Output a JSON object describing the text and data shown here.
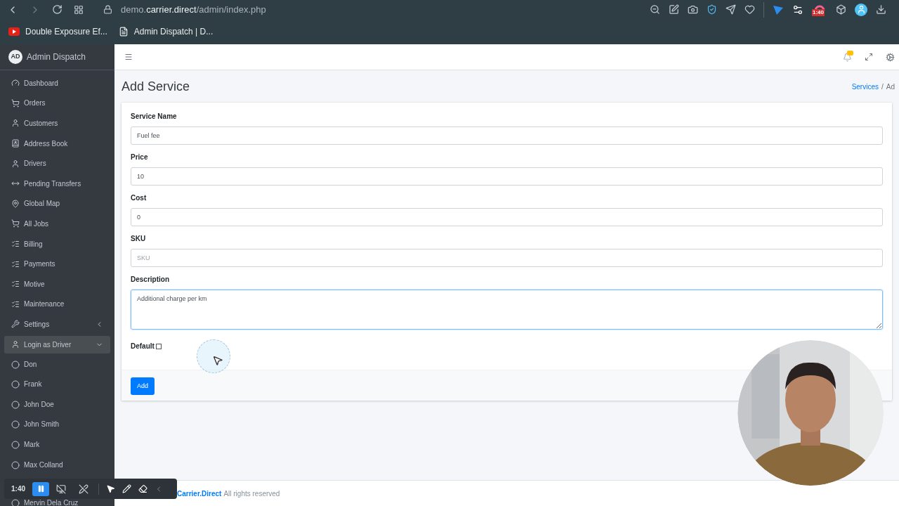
{
  "browser": {
    "url": {
      "scheme_host_prefix": "demo.",
      "host": "carrier.direct",
      "path": "/admin/index.php"
    },
    "extension_badge": "1:40",
    "bookmarks": [
      {
        "label": "Double Exposure Ef...",
        "kind": "video"
      },
      {
        "label": "Admin Dispatch | D...",
        "kind": "page"
      }
    ]
  },
  "sidebar": {
    "avatar": "AD",
    "brand": "Admin Dispatch",
    "items": [
      {
        "label": "Dashboard",
        "kind": "link",
        "selected": false
      },
      {
        "label": "Orders",
        "kind": "link",
        "selected": false
      },
      {
        "label": "Customers",
        "kind": "link",
        "selected": false
      },
      {
        "label": "Address Book",
        "kind": "link",
        "selected": false
      },
      {
        "label": "Drivers",
        "kind": "link",
        "selected": false
      },
      {
        "label": "Pending Transfers",
        "kind": "link",
        "selected": false
      },
      {
        "label": "Global Map",
        "kind": "link",
        "selected": false
      },
      {
        "label": "All Jobs",
        "kind": "link",
        "selected": false
      },
      {
        "label": "Billing",
        "kind": "link",
        "selected": false
      },
      {
        "label": "Payments",
        "kind": "link",
        "selected": false
      },
      {
        "label": "Motive",
        "kind": "link",
        "selected": false
      },
      {
        "label": "Maintenance",
        "kind": "link",
        "selected": false
      },
      {
        "label": "Settings",
        "kind": "group",
        "selected": false,
        "expanded": false
      },
      {
        "label": "Login as Driver",
        "kind": "group",
        "selected": true,
        "expanded": true,
        "children": [
          {
            "label": "Don"
          },
          {
            "label": "Frank"
          },
          {
            "label": "John Doe"
          },
          {
            "label": "John Smith"
          },
          {
            "label": "Mark"
          },
          {
            "label": "Max Colland"
          },
          {
            "label": "Mervin Dela Cruz"
          }
        ]
      }
    ]
  },
  "page": {
    "title": "Add Service",
    "breadcrumb_separator": "/",
    "breadcrumb": [
      {
        "label": "Services",
        "selected": false
      },
      {
        "label": "Ad",
        "selected": true
      }
    ]
  },
  "form": {
    "fields": [
      {
        "label": "Service Name",
        "kind": "input",
        "value": "Fuel fee",
        "focused": false
      },
      {
        "label": "Price",
        "kind": "input",
        "value": "10",
        "focused": false
      },
      {
        "label": "Cost",
        "kind": "input",
        "value": "0",
        "focused": false
      },
      {
        "label": "SKU",
        "kind": "input",
        "placeholder": "SKU",
        "focused": false
      },
      {
        "label": "Description",
        "kind": "textarea",
        "value": "Additional charge per km",
        "focused": true
      }
    ],
    "default": {
      "label": "Default",
      "checked": false
    },
    "submit": "Add"
  },
  "footer": {
    "link": "Carrier.Direct",
    "text": "All rights reserved"
  },
  "recorder": {
    "time": "1:40",
    "paused": false
  }
}
